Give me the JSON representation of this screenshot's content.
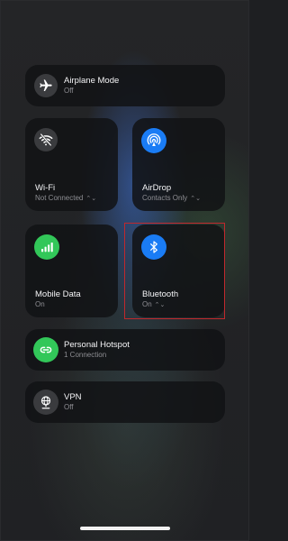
{
  "airplane": {
    "title": "Airplane Mode",
    "status": "Off",
    "icon": "airplane-icon"
  },
  "wifi": {
    "title": "Wi-Fi",
    "status": "Not Connected",
    "chevron": "⌃⌄",
    "icon": "wifi-off-icon"
  },
  "airdrop": {
    "title": "AirDrop",
    "status": "Contacts Only",
    "chevron": "⌃⌄",
    "icon": "airdrop-icon"
  },
  "mobile_data": {
    "title": "Mobile Data",
    "status": "On",
    "icon": "cellular-icon"
  },
  "bluetooth": {
    "title": "Bluetooth",
    "status": "On",
    "chevron": "⌃⌄",
    "icon": "bluetooth-icon"
  },
  "hotspot": {
    "title": "Personal Hotspot",
    "status": "1 Connection",
    "icon": "hotspot-icon"
  },
  "vpn": {
    "title": "VPN",
    "status": "Off",
    "icon": "vpn-globe-icon"
  },
  "colors": {
    "blue": "#1a7cf5",
    "green": "#32c759",
    "highlight": "#c0282d",
    "tile": "#121315"
  }
}
